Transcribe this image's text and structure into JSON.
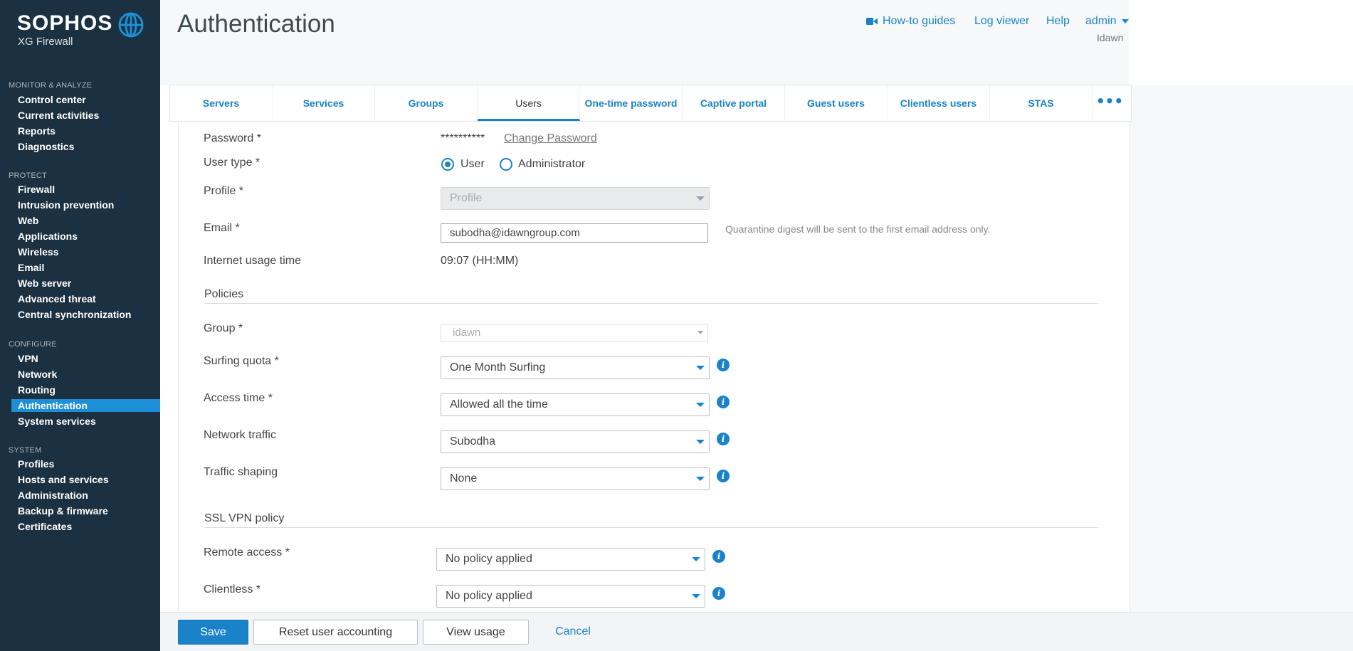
{
  "brand": {
    "name": "SOPHOS",
    "product": "XG Firewall"
  },
  "sidebar": {
    "sections": [
      {
        "title": "MONITOR & ANALYZE",
        "items": [
          "Control center",
          "Current activities",
          "Reports",
          "Diagnostics"
        ]
      },
      {
        "title": "PROTECT",
        "items": [
          "Firewall",
          "Intrusion prevention",
          "Web",
          "Applications",
          "Wireless",
          "Email",
          "Web server",
          "Advanced threat",
          "Central synchronization"
        ]
      },
      {
        "title": "CONFIGURE",
        "items": [
          "VPN",
          "Network",
          "Routing",
          "Authentication",
          "System services"
        ]
      },
      {
        "title": "SYSTEM",
        "items": [
          "Profiles",
          "Hosts and services",
          "Administration",
          "Backup & firmware",
          "Certificates"
        ]
      }
    ],
    "active": "Authentication"
  },
  "header": {
    "title": "Authentication",
    "links": {
      "guides": "How-to guides",
      "log_viewer": "Log viewer",
      "help": "Help",
      "user": "admin"
    },
    "org": "Idawn"
  },
  "tabs": [
    "Servers",
    "Services",
    "Groups",
    "Users",
    "One-time password",
    "Captive portal",
    "Guest users",
    "Clientless users",
    "STAS"
  ],
  "active_tab": "Users",
  "form": {
    "password": {
      "label": "Password *",
      "value": "**********",
      "change_link": "Change Password"
    },
    "user_type": {
      "label": "User type *",
      "options": [
        "User",
        "Administrator"
      ],
      "selected": "User"
    },
    "profile": {
      "label": "Profile *",
      "value": "Profile"
    },
    "email": {
      "label": "Email *",
      "value": "subodha@idawngroup.com",
      "hint": "Quarantine digest will be sent to the first email address only."
    },
    "internet_usage": {
      "label": "Internet usage time",
      "value": "09:07 (HH:MM)"
    },
    "policies": {
      "title": "Policies",
      "group": {
        "label": "Group *",
        "value": "idawn"
      },
      "surfing_quota": {
        "label": "Surfing quota *",
        "value": "One Month Surfing"
      },
      "access_time": {
        "label": "Access time *",
        "value": "Allowed all the time"
      },
      "network_traffic": {
        "label": "Network traffic",
        "value": "Subodha"
      },
      "traffic_shaping": {
        "label": "Traffic shaping",
        "value": "None"
      }
    },
    "ssl_vpn": {
      "title": "SSL VPN policy",
      "remote_access": {
        "label": "Remote access *",
        "value": "No policy applied"
      },
      "clientless": {
        "label": "Clientless *",
        "value": "No policy applied"
      }
    }
  },
  "footer": {
    "save": "Save",
    "reset": "Reset user accounting",
    "view_usage": "View usage",
    "cancel": "Cancel"
  },
  "colors": {
    "sidebar_bg": "#1b3040",
    "accent": "#1a82c9",
    "active_nav": "#1d8fd6"
  },
  "icons": {
    "globe": "globe-icon",
    "video": "video-camera-icon",
    "info": "info-icon",
    "more": "more-dots-icon"
  }
}
